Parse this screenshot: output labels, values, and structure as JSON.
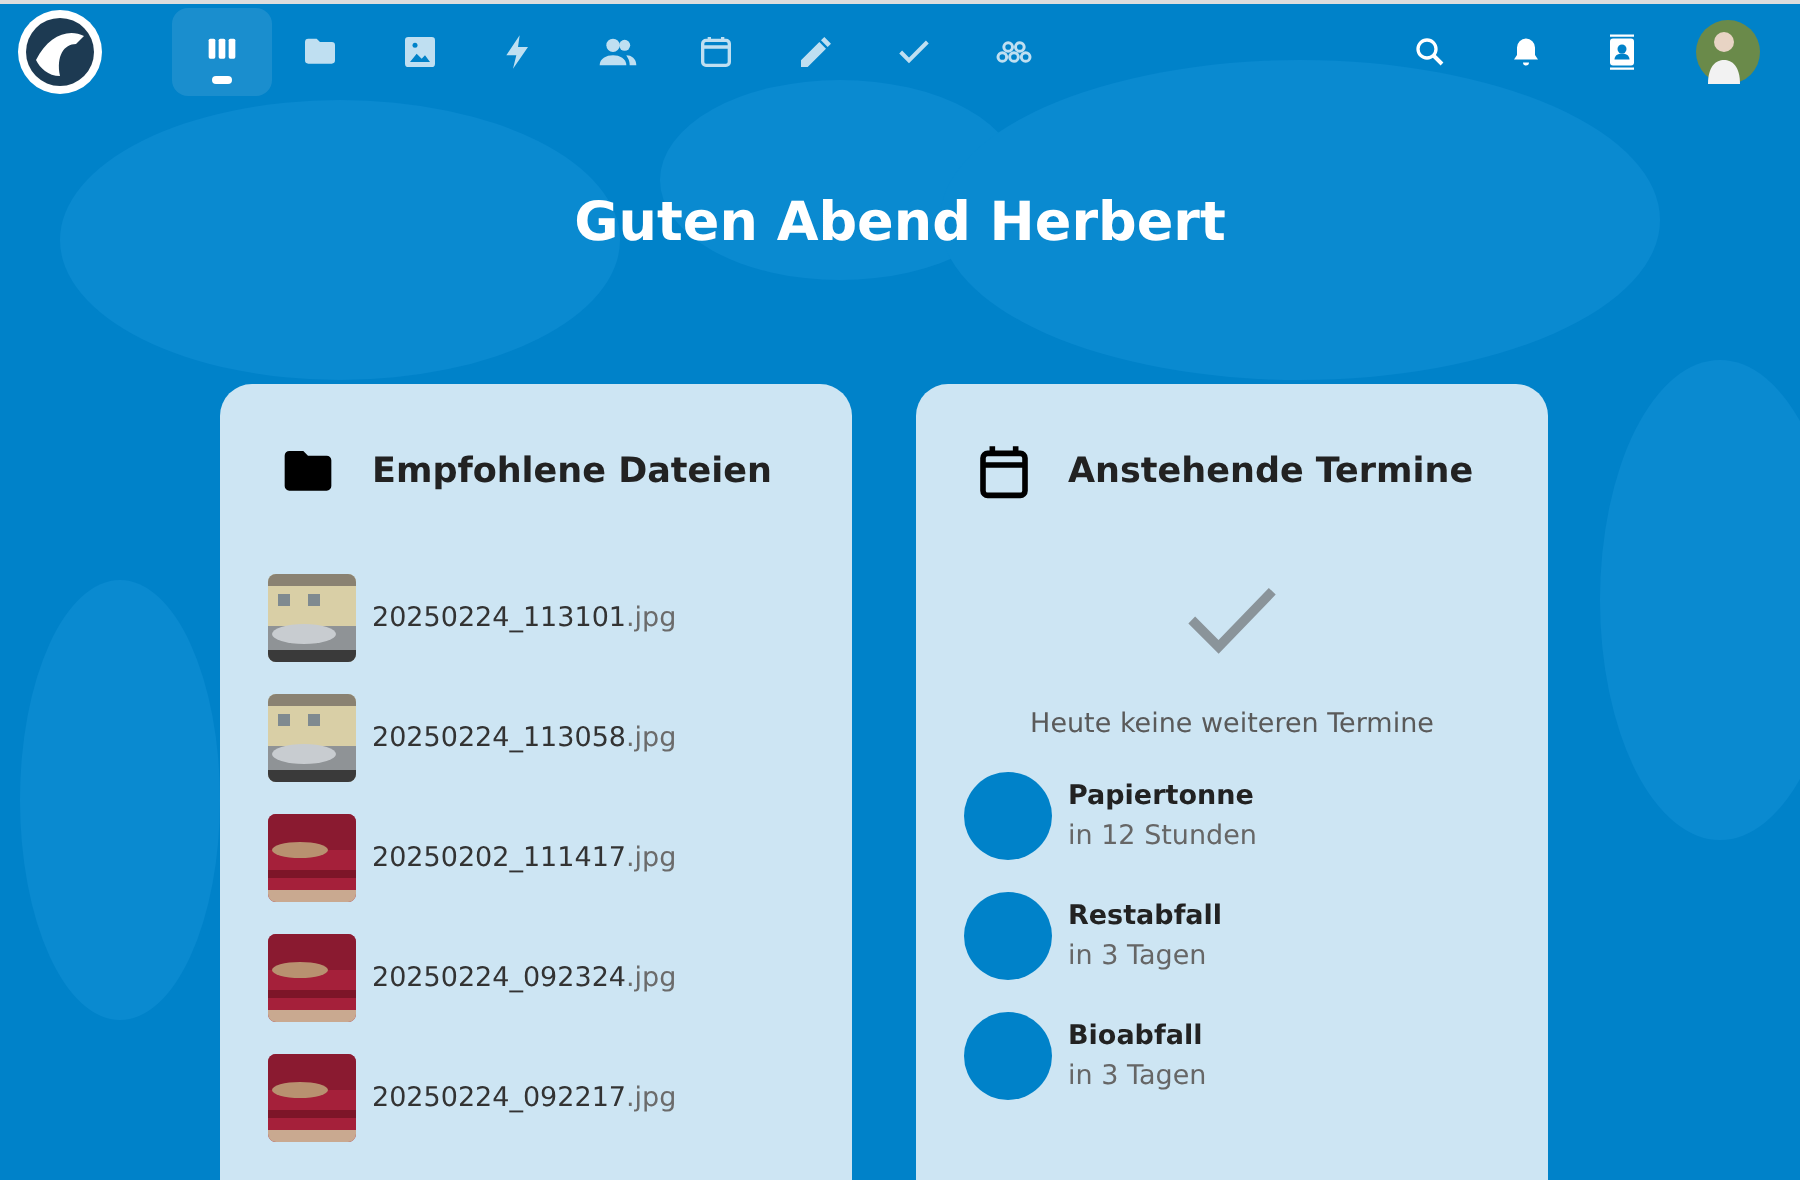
{
  "header": {
    "apps": [
      {
        "kind": "dashboard",
        "selected": true
      },
      {
        "kind": "files",
        "selected": false
      },
      {
        "kind": "photos",
        "selected": false
      },
      {
        "kind": "activity",
        "selected": false
      },
      {
        "kind": "contacts",
        "selected": false
      },
      {
        "kind": "calendar",
        "selected": false
      },
      {
        "kind": "notes",
        "selected": false
      },
      {
        "kind": "tasks",
        "selected": false
      },
      {
        "kind": "circles",
        "selected": false
      }
    ]
  },
  "greeting": "Guten Abend Herbert",
  "widgets": [
    {
      "kind": "files",
      "title": "Empfohlene Dateien",
      "items": [
        {
          "name": "20250224_113101",
          "extension": ".jpg"
        },
        {
          "name": "20250224_113058",
          "extension": ".jpg"
        },
        {
          "name": "20250202_111417",
          "extension": ".jpg"
        },
        {
          "name": "20250224_092324",
          "extension": ".jpg"
        },
        {
          "name": "20250224_092217",
          "extension": ".jpg"
        }
      ]
    },
    {
      "kind": "calendar",
      "title": "Anstehende Termine",
      "empty_message": "Heute keine weiteren Termine",
      "items": [
        {
          "name": "Papiertonne",
          "when": "in 12 Stunden"
        },
        {
          "name": "Restabfall",
          "when": "in 3 Tagen"
        },
        {
          "name": "Bioabfall",
          "when": "in 3 Tagen"
        }
      ]
    }
  ]
}
